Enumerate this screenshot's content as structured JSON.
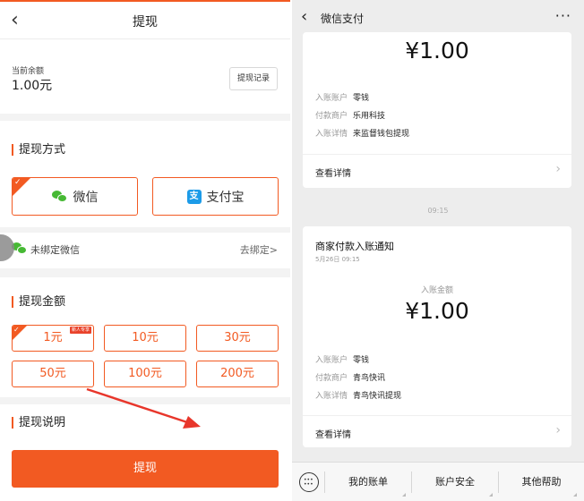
{
  "left": {
    "header": {
      "back_icon": "chevron-left-icon",
      "title": "提现"
    },
    "balance": {
      "label": "当前余额",
      "value": "1.00元",
      "record_button": "提现记录"
    },
    "method": {
      "section_title": "提现方式",
      "options": [
        {
          "label": "微信",
          "icon": "wechat-icon",
          "selected": true
        },
        {
          "label": "支付宝",
          "icon": "alipay-icon",
          "selected": false
        }
      ],
      "alipay_glyph": "支",
      "bind_text": "未绑定微信",
      "unbind_link": "去绑定>"
    },
    "amount": {
      "section_title": "提现金额",
      "new_badge": "新人专享",
      "options": [
        "1元",
        "10元",
        "30元",
        "50元",
        "100元",
        "200元"
      ],
      "selected_index": 0
    },
    "note": {
      "section_title": "提现说明"
    },
    "submit_button": "提现",
    "colors": {
      "accent": "#f25a22",
      "wechat": "#46b934",
      "alipay": "#1c9be8"
    }
  },
  "right": {
    "header": {
      "back_icon": "chevron-left-icon",
      "title": "微信支付",
      "more": "···"
    },
    "card1": {
      "amount": "¥1.00",
      "rows": [
        {
          "key": "入账账户",
          "value": "零钱"
        },
        {
          "key": "付款商户",
          "value": "乐用科技"
        },
        {
          "key": "入账详情",
          "value": "来监督钱包提现"
        }
      ],
      "detail_link": "查看详情"
    },
    "time_separator": "09:15",
    "card2": {
      "title": "商家付款入账通知",
      "date": "5月26日 09:15",
      "amount_label": "入账金额",
      "amount": "¥1.00",
      "rows": [
        {
          "key": "入账账户",
          "value": "零钱"
        },
        {
          "key": "付款商户",
          "value": "青鸟快讯"
        },
        {
          "key": "入账详情",
          "value": "青鸟快讯提现"
        }
      ],
      "detail_link": "查看详情"
    },
    "bottom_menu": [
      "我的账单",
      "账户安全",
      "其他帮助"
    ],
    "arrow_glyph": "›"
  }
}
